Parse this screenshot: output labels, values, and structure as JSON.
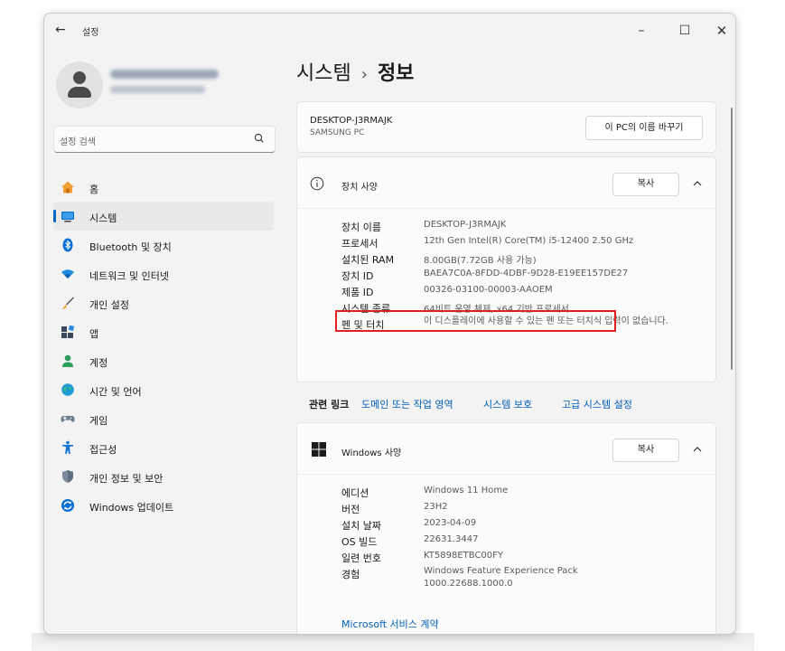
{
  "window": {
    "title": "설정",
    "back": "←",
    "minimize": "–",
    "maximize": "☐",
    "close": "✕"
  },
  "search": {
    "placeholder": "설정 검색"
  },
  "sidebar": {
    "items": [
      {
        "label": "홈",
        "icon": "home-icon"
      },
      {
        "label": "시스템",
        "icon": "system-icon",
        "active": true
      },
      {
        "label": "Bluetooth 및 장치",
        "icon": "bluetooth-icon"
      },
      {
        "label": "네트워크 및 인터넷",
        "icon": "network-icon"
      },
      {
        "label": "개인 설정",
        "icon": "brush-icon"
      },
      {
        "label": "앱",
        "icon": "apps-icon"
      },
      {
        "label": "계정",
        "icon": "account-icon"
      },
      {
        "label": "시간 및 언어",
        "icon": "globe-clock-icon"
      },
      {
        "label": "게임",
        "icon": "game-icon"
      },
      {
        "label": "접근성",
        "icon": "accessibility-icon"
      },
      {
        "label": "개인 정보 및 보안",
        "icon": "shield-icon"
      },
      {
        "label": "Windows 업데이트",
        "icon": "update-icon"
      }
    ]
  },
  "header": {
    "breadcrumb_parent": "시스템",
    "separator": "›",
    "breadcrumb_current": "정보"
  },
  "pc": {
    "name": "DESKTOP-J3RMAJK",
    "model": "SAMSUNG PC",
    "rename_label": "이 PC의 이름 바꾸기"
  },
  "device_specs": {
    "title": "장치 사양",
    "copy_label": "복사",
    "rows": [
      {
        "key": "장치 이름",
        "value": "DESKTOP-J3RMAJK"
      },
      {
        "key": "프로세서",
        "value": "12th Gen Intel(R) Core(TM) i5-12400   2.50 GHz"
      },
      {
        "key": "설치된 RAM",
        "value": "8.00GB(7.72GB 사용 가능)"
      },
      {
        "key": "장치 ID",
        "value": "BAEA7C0A-8FDD-4DBF-9D28-E19EE157DE27"
      },
      {
        "key": "제품 ID",
        "value": "00326-03100-00003-AAOEM"
      },
      {
        "key": "시스템 종류",
        "value": "64비트 운영 체제, x64 기반 프로세서"
      },
      {
        "key": "펜 및 터치",
        "value": "이 디스플레이에 사용할 수 있는 펜 또는 터치식 입력이 없습니다."
      }
    ]
  },
  "related": {
    "label": "관련 링크",
    "links": [
      "도메인 또는 작업 영역",
      "시스템 보호",
      "고급 시스템 설정"
    ]
  },
  "windows_specs": {
    "title": "Windows 사양",
    "copy_label": "복사",
    "rows": [
      {
        "key": "에디션",
        "value": "Windows 11 Home"
      },
      {
        "key": "버전",
        "value": "23H2"
      },
      {
        "key": "설치 날짜",
        "value": "2023-04-09"
      },
      {
        "key": "OS 빌드",
        "value": "22631.3447"
      },
      {
        "key": "일련 번호",
        "value": "KT5898ETBC00FY"
      },
      {
        "key": "경험",
        "value": "Windows Feature Experience Pack 1000.22688.1000.0"
      }
    ],
    "ms_link": "Microsoft 서비스 계약"
  },
  "colors": {
    "accent": "#0067c0",
    "link": "#005fb8",
    "highlight_box": "#e02020"
  }
}
